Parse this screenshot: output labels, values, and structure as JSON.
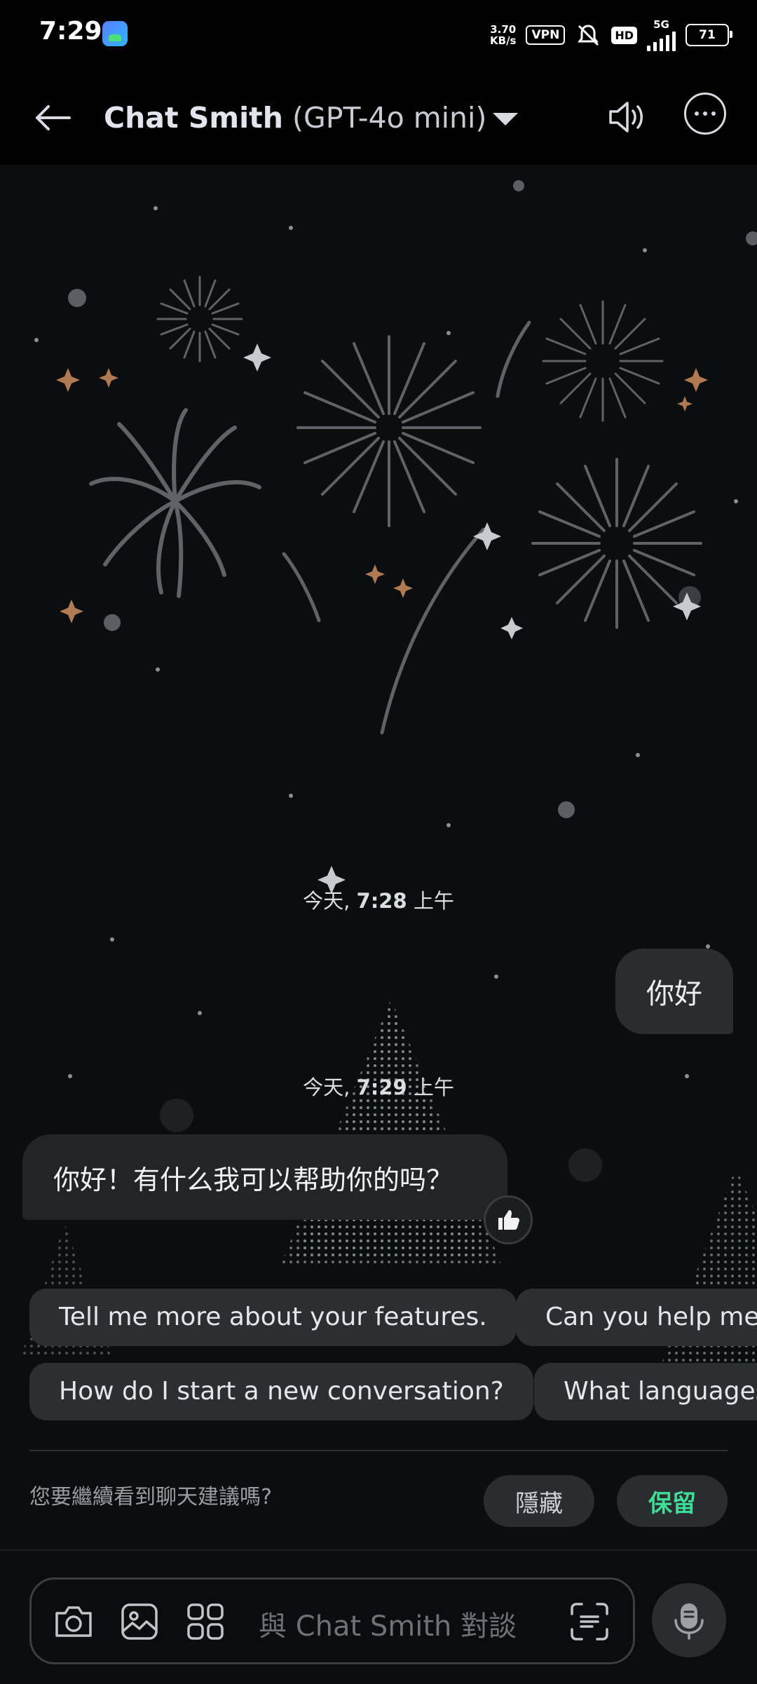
{
  "status_bar": {
    "time": "7:29",
    "speed_value": "3.70",
    "speed_unit": "KB/s",
    "vpn": "VPN",
    "hd": "HD",
    "network": "5G",
    "battery": "71",
    "app_icon": "gallery-icon"
  },
  "header": {
    "back_icon": "arrow-left-icon",
    "bot_name": "Chat Smith",
    "model": " (GPT-4o mini)",
    "dropdown_icon": "caret-down-icon",
    "speaker_icon": "speaker-icon",
    "more_icon": "more-horizontal-icon"
  },
  "messages": [
    {
      "timestamp_day": "今天, ",
      "timestamp_time": "7:28",
      "timestamp_ampm": " 上午",
      "role": "user",
      "text": "你好"
    },
    {
      "timestamp_day": "今天, ",
      "timestamp_time": "7:29",
      "timestamp_ampm": " 上午",
      "role": "assistant",
      "text": "你好！有什么我可以帮助你的吗？"
    }
  ],
  "suggestions": [
    "Tell me more about your features.",
    "Can you help me",
    "How do I start a new conversation?",
    "What languages"
  ],
  "suggestion_prompt": {
    "question": "您要繼續看到聊天建議嗎?",
    "hide_label": "隱藏",
    "keep_label": "保留"
  },
  "input": {
    "placeholder": "與 Chat Smith 對談",
    "camera_icon": "camera-icon",
    "image_icon": "image-icon",
    "apps_icon": "grid-icon",
    "scan_icon": "scan-text-icon",
    "mic_icon": "microphone-icon"
  },
  "colors": {
    "background": "#0b0d0f",
    "bubble": "#2b2c30",
    "accent_green": "#3ddc97"
  }
}
